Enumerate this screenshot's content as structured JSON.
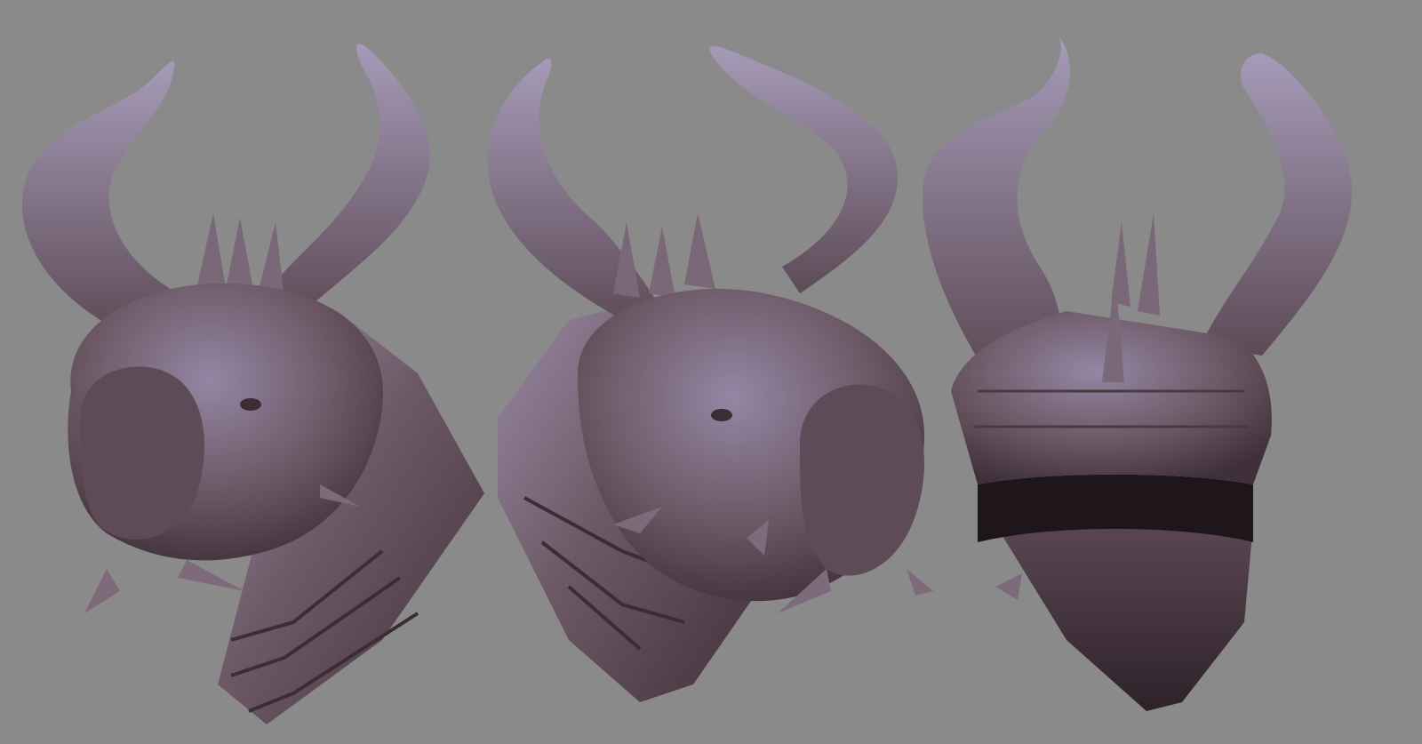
{
  "scene": {
    "background_color": "#8a8a8a",
    "material_base": "#6e5a66",
    "material_highlight": "#a69bb8",
    "material_shadow": "#3b2c36",
    "views": [
      {
        "id": "front",
        "subject": "dragon-head-sculpt"
      },
      {
        "id": "three-quarter",
        "subject": "dragon-head-sculpt"
      },
      {
        "id": "back",
        "subject": "dragon-head-sculpt"
      }
    ]
  }
}
